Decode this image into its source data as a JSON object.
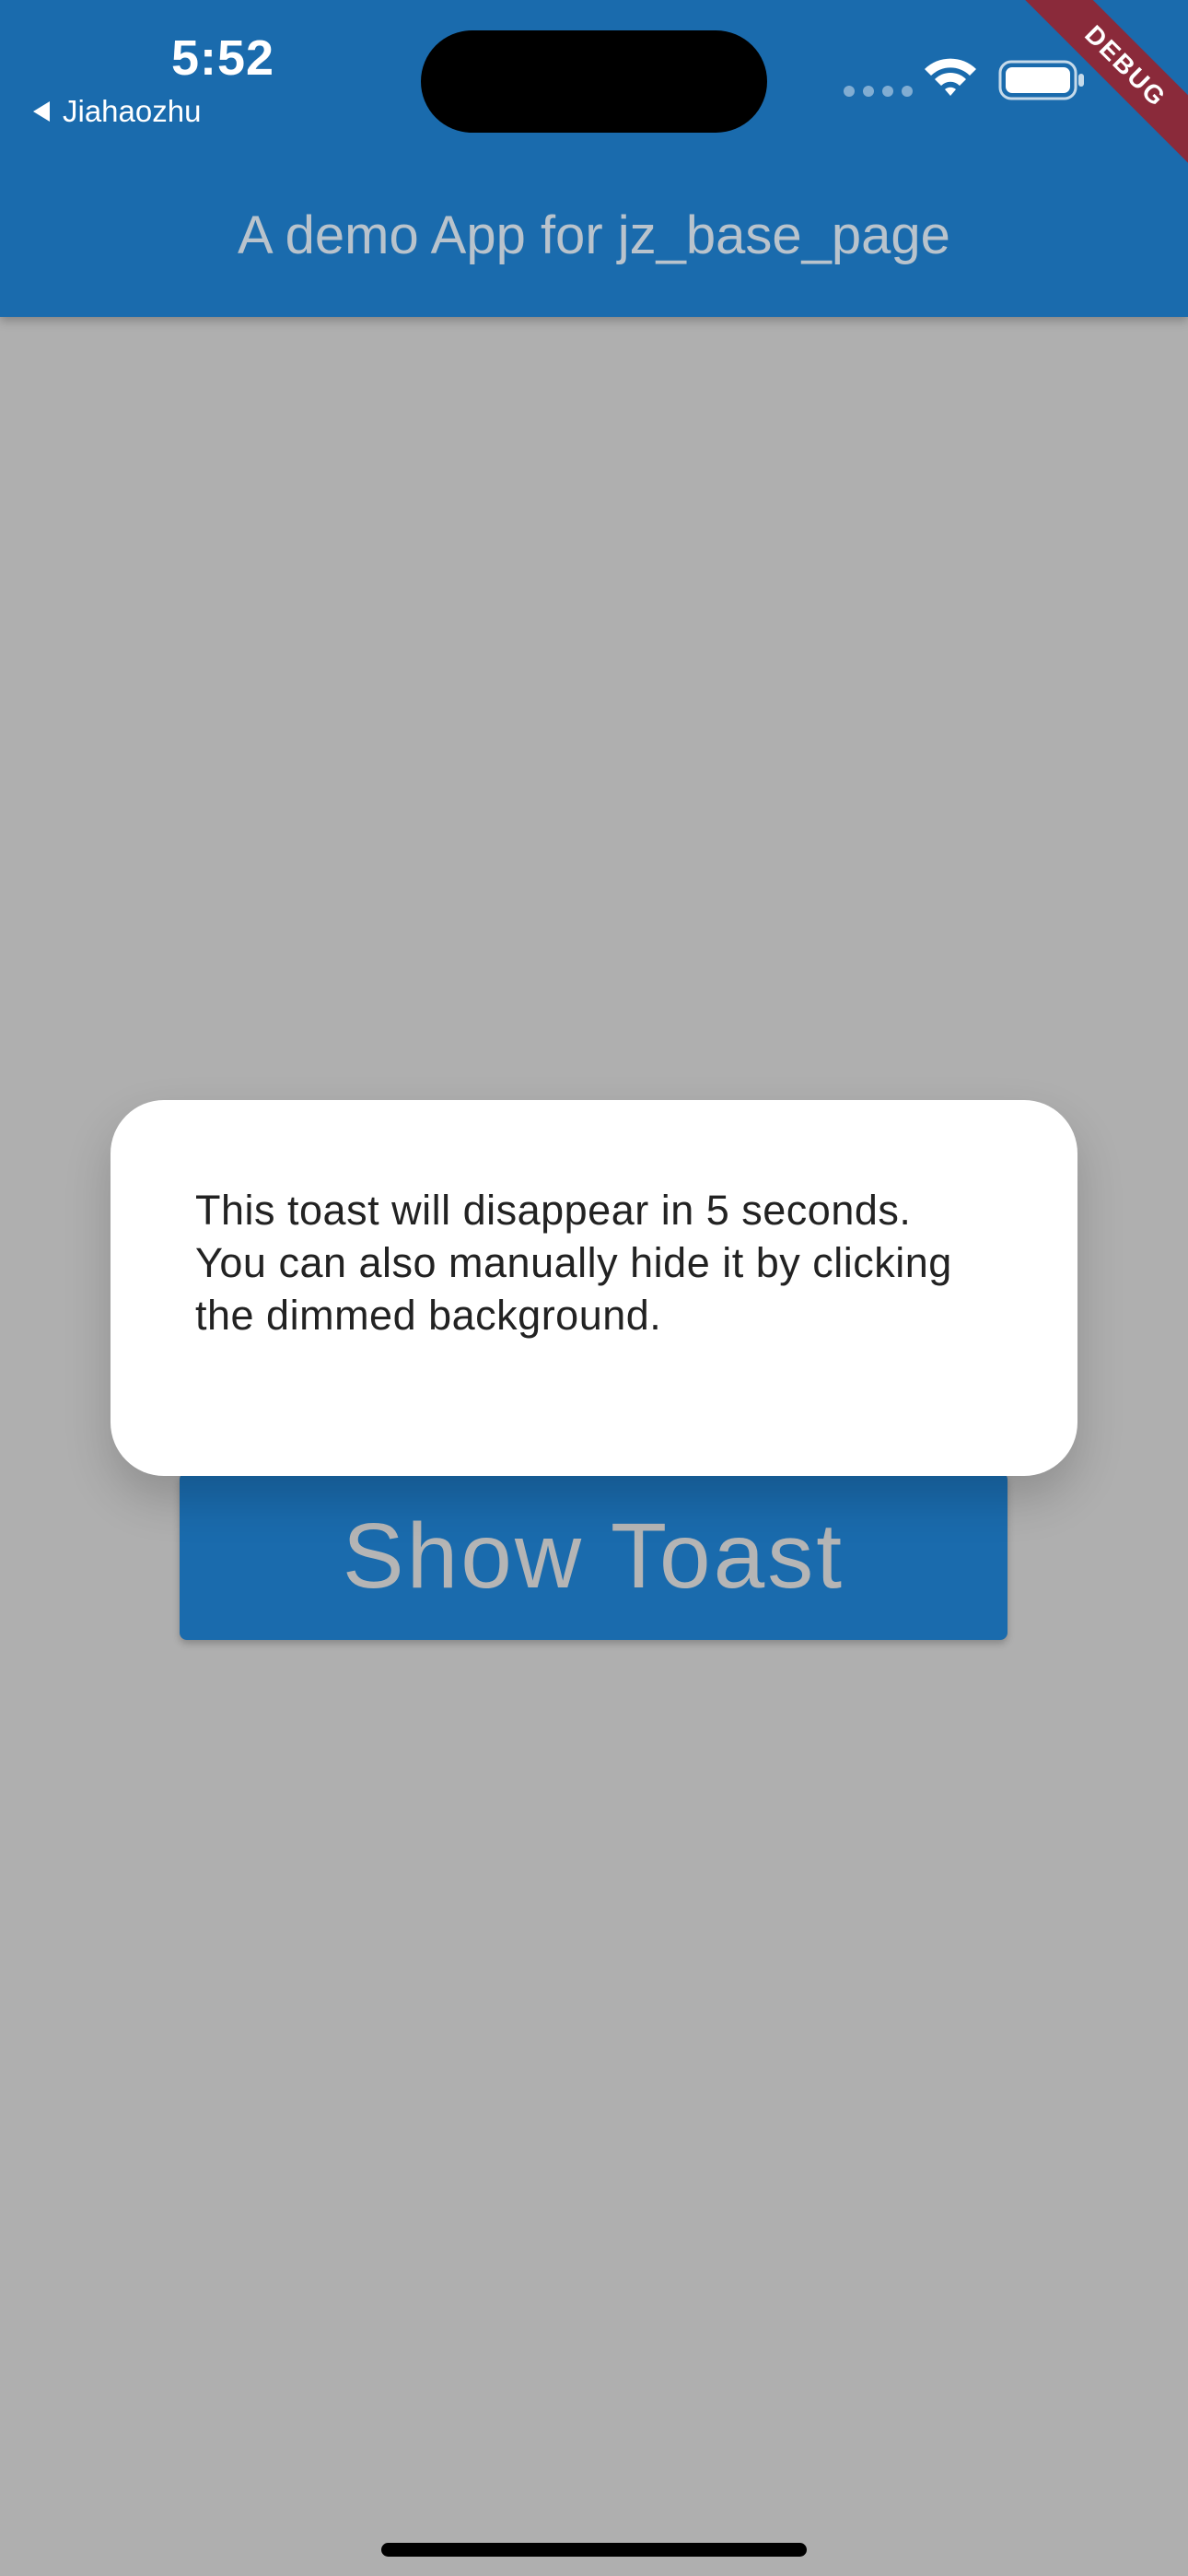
{
  "status_bar": {
    "time": "5:52",
    "back_app": "Jiahaozhu"
  },
  "debug_banner": "DEBUG",
  "app_bar": {
    "title": "A demo App for jz_base_page",
    "background_color": "#1A6BAD"
  },
  "main": {
    "show_toast_label": "Show Toast"
  },
  "toast": {
    "message": "This toast will disappear in 5 seconds. You can also manually hide it by clicking the dimmed background."
  },
  "icons": {
    "signal": "cellular-signal-icon",
    "wifi": "wifi-icon",
    "battery": "battery-icon",
    "back": "back-triangle-icon"
  },
  "colors": {
    "dimmed_background": "#AFAFAF",
    "accent": "#1A6BAD",
    "debug_ribbon": "#8A2A3A"
  }
}
